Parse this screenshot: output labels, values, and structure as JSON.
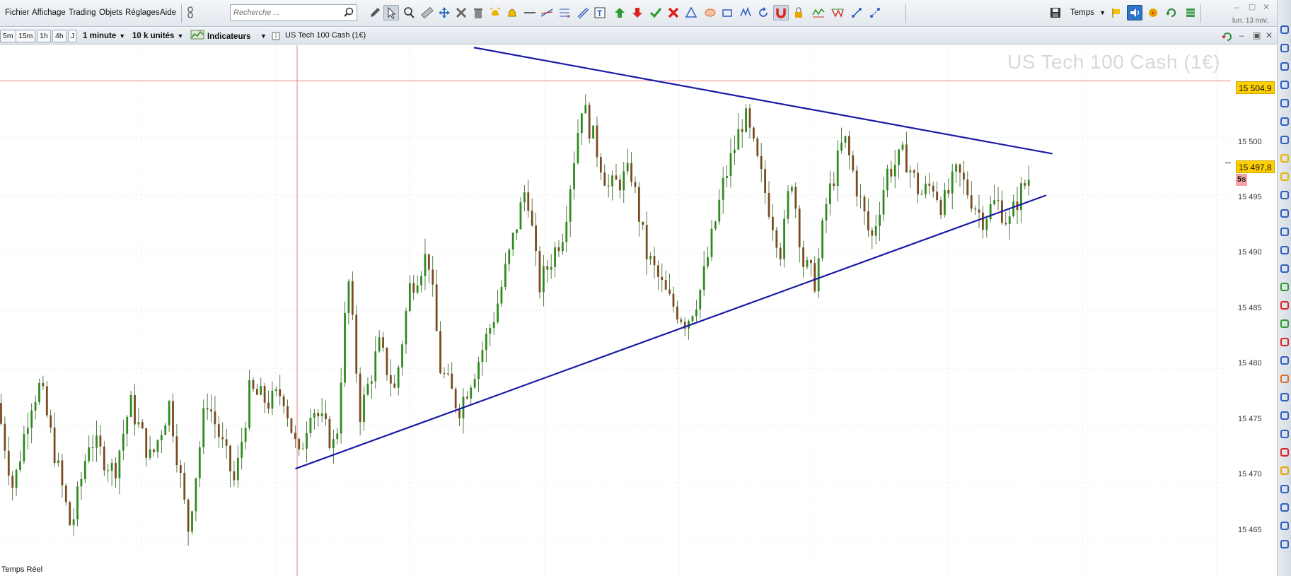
{
  "menu": {
    "items": [
      "Fichier",
      "Affichage",
      "Trading",
      "Objets",
      "Réglages",
      "Aide"
    ]
  },
  "search": {
    "placeholder": "Recherche ..."
  },
  "toolbar": {
    "time_label": "Temps",
    "date_label": "lun. 13 nov.",
    "icons": [
      "pencil-icon",
      "cursor-icon",
      "zoom-icon",
      "ruler-icon",
      "move-icon",
      "tools-icon",
      "trash-icon",
      "alert-manager-icon",
      "bell-icon",
      "horizontal-line-icon",
      "trend-line-icon",
      "fibonacci-icon",
      "channel-icon",
      "text-icon",
      "buy-arrow-icon",
      "sell-arrow-icon",
      "check-icon",
      "cross-icon",
      "triangle-icon",
      "ellipse-icon",
      "rectangle-icon",
      "pattern-icon",
      "reset-icon",
      "magnet-icon",
      "lock-icon",
      "wave-icon",
      "zigzag-icon",
      "link-icon",
      "dotted-link-icon"
    ],
    "right_icons": [
      "save-icon",
      "flag-icon",
      "sound-icon",
      "add-alert-icon",
      "refresh-icon",
      "grid-icon"
    ]
  },
  "chart_bar": {
    "timeframes": [
      "5m",
      "15m",
      "1h",
      "4h",
      "J"
    ],
    "interval": "1 minute",
    "units": "10 k unités",
    "indicators": "Indicateurs",
    "instrument": "US Tech 100 Cash (1€)"
  },
  "watermark": "US Tech 100 Cash (1€)",
  "status": "Temps Réel",
  "price_axis": {
    "ticks": [
      "15 500",
      "15 495",
      "15 490",
      "15 485",
      "15 480",
      "15 475",
      "15 470",
      "15 465"
    ],
    "high_line_label": "15 504,9",
    "current_price": "15 497,8",
    "countdown": "5s"
  },
  "colors": {
    "bull": "#2e8b1e",
    "bear": "#7a4a20",
    "trend_lines": "#1a1aa6",
    "crosshair": "#e85a5a",
    "badge": "#ffd000"
  },
  "chart_data": {
    "type": "candlestick",
    "ylim": [
      15462,
      15508
    ],
    "horizontal_line": 15504.9,
    "current_price": 15497.8,
    "trend_lines": [
      {
        "name": "",
        "from": [
          0.385,
          15507.8
        ],
        "to": [
          0.855,
          15498.6
        ]
      },
      {
        "name": "",
        "from": [
          0.24,
          15471.3
        ],
        "to": [
          0.85,
          15495.0
        ]
      }
    ],
    "anchors": [
      [
        0.0,
        15477
      ],
      [
        0.013,
        15469.5
      ],
      [
        0.027,
        15477
      ],
      [
        0.035,
        15478.5
      ],
      [
        0.06,
        15466
      ],
      [
        0.075,
        15474
      ],
      [
        0.095,
        15471
      ],
      [
        0.108,
        15477
      ],
      [
        0.125,
        15472
      ],
      [
        0.14,
        15477
      ],
      [
        0.155,
        15466
      ],
      [
        0.17,
        15477.5
      ],
      [
        0.193,
        15470
      ],
      [
        0.205,
        15478
      ],
      [
        0.222,
        15477
      ],
      [
        0.232,
        15478
      ],
      [
        0.245,
        15472
      ],
      [
        0.255,
        15477
      ],
      [
        0.275,
        15473
      ],
      [
        0.285,
        15488
      ],
      [
        0.295,
        15476
      ],
      [
        0.31,
        15482
      ],
      [
        0.323,
        15478
      ],
      [
        0.335,
        15487
      ],
      [
        0.35,
        15490
      ],
      [
        0.36,
        15480
      ],
      [
        0.375,
        15476.5
      ],
      [
        0.392,
        15481
      ],
      [
        0.405,
        15485
      ],
      [
        0.43,
        15496
      ],
      [
        0.44,
        15487
      ],
      [
        0.46,
        15492
      ],
      [
        0.475,
        15503
      ],
      [
        0.487,
        15499
      ],
      [
        0.497,
        15495.5
      ],
      [
        0.515,
        15497
      ],
      [
        0.527,
        15490
      ],
      [
        0.545,
        15486
      ],
      [
        0.56,
        15484
      ],
      [
        0.572,
        15487
      ],
      [
        0.59,
        15496
      ],
      [
        0.607,
        15502
      ],
      [
        0.622,
        15496
      ],
      [
        0.637,
        15490
      ],
      [
        0.645,
        15497
      ],
      [
        0.655,
        15489
      ],
      [
        0.665,
        15487.5
      ],
      [
        0.673,
        15494
      ],
      [
        0.688,
        15500
      ],
      [
        0.7,
        15495
      ],
      [
        0.71,
        15491
      ],
      [
        0.723,
        15497
      ],
      [
        0.737,
        15498.5
      ],
      [
        0.75,
        15495
      ],
      [
        0.76,
        15496
      ],
      [
        0.768,
        15494
      ],
      [
        0.78,
        15497
      ],
      [
        0.79,
        15495
      ],
      [
        0.8,
        15493
      ],
      [
        0.812,
        15494.5
      ],
      [
        0.822,
        15492.5
      ],
      [
        0.83,
        15495
      ],
      [
        0.838,
        15496.5
      ]
    ]
  }
}
